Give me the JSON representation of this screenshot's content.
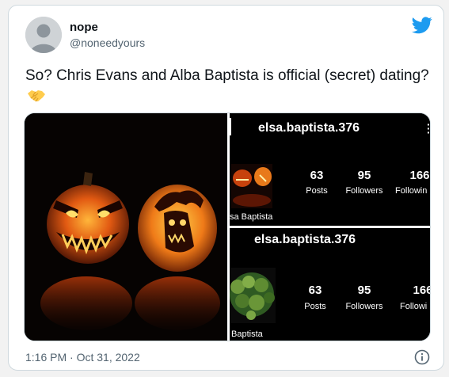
{
  "tweet": {
    "display_name": "nope",
    "handle": "@noneedyours",
    "text": "So? Chris Evans and Alba Baptista is official (secret) dating?",
    "timestamp": "1:16 PM · Oct 31, 2022"
  },
  "instagram_top": {
    "username": "elsa.baptista.376",
    "posts": "63",
    "posts_label": "Posts",
    "followers": "95",
    "followers_label": "Followers",
    "following": "166",
    "following_label": "Followin",
    "name_fragment": "sa Baptista"
  },
  "instagram_bottom": {
    "username": "elsa.baptista.376",
    "posts": "63",
    "posts_label": "Posts",
    "followers": "95",
    "followers_label": "Followers",
    "following": "166",
    "following_label": "Followi",
    "name_fragment": "Baptista"
  },
  "icons": {
    "brand": "twitter-bird-icon",
    "emoji": "handshake-emoji",
    "info": "info-icon"
  },
  "colors": {
    "twitter_blue": "#1d9bf0",
    "text": "#0f1419",
    "muted": "#536471"
  }
}
